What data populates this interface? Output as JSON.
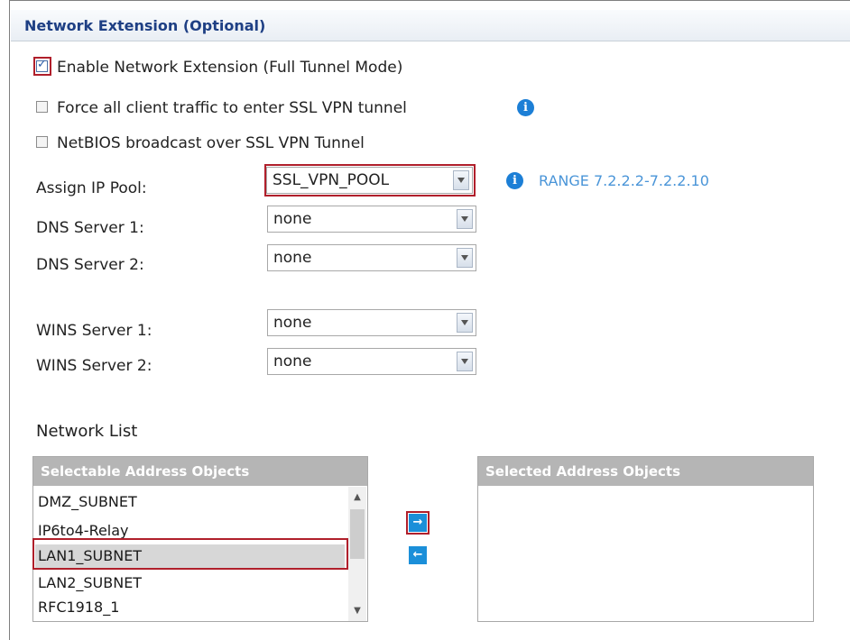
{
  "section": {
    "title": "Network Extension (Optional)"
  },
  "options": [
    {
      "label": "Enable Network Extension (Full Tunnel Mode)",
      "checked": true
    },
    {
      "label": "Force all client traffic to enter SSL VPN tunnel",
      "checked": false
    },
    {
      "label": "NetBIOS broadcast over SSL VPN Tunnel",
      "checked": false
    }
  ],
  "fields": {
    "ip_pool": {
      "label": "Assign IP Pool:",
      "value": "SSL_VPN_POOL",
      "range": "RANGE 7.2.2.2-7.2.2.10"
    },
    "dns1": {
      "label": "DNS Server 1:",
      "value": "none"
    },
    "dns2": {
      "label": "DNS Server 2:",
      "value": "none"
    },
    "wins1": {
      "label": "WINS Server 1:",
      "value": "none"
    },
    "wins2": {
      "label": "WINS Server 2:",
      "value": "none"
    }
  },
  "network_list": {
    "title": "Network List",
    "selectable_header": "Selectable Address Objects",
    "selected_header": "Selected Address Objects",
    "selectable_items": [
      "DMZ_SUBNET",
      "IP6to4-Relay",
      "LAN1_SUBNET",
      "LAN2_SUBNET",
      "RFC1918_1"
    ],
    "selected_item_index": 2,
    "selected_items": []
  },
  "icons": {
    "info": "i",
    "add_arrow": "→",
    "remove_arrow": "←",
    "scroll_up": "▲",
    "scroll_down": "▼",
    "check": "✓"
  },
  "colors": {
    "highlight": "#b01f2b",
    "accent": "#1b8fd9",
    "title": "#1e3f84"
  }
}
